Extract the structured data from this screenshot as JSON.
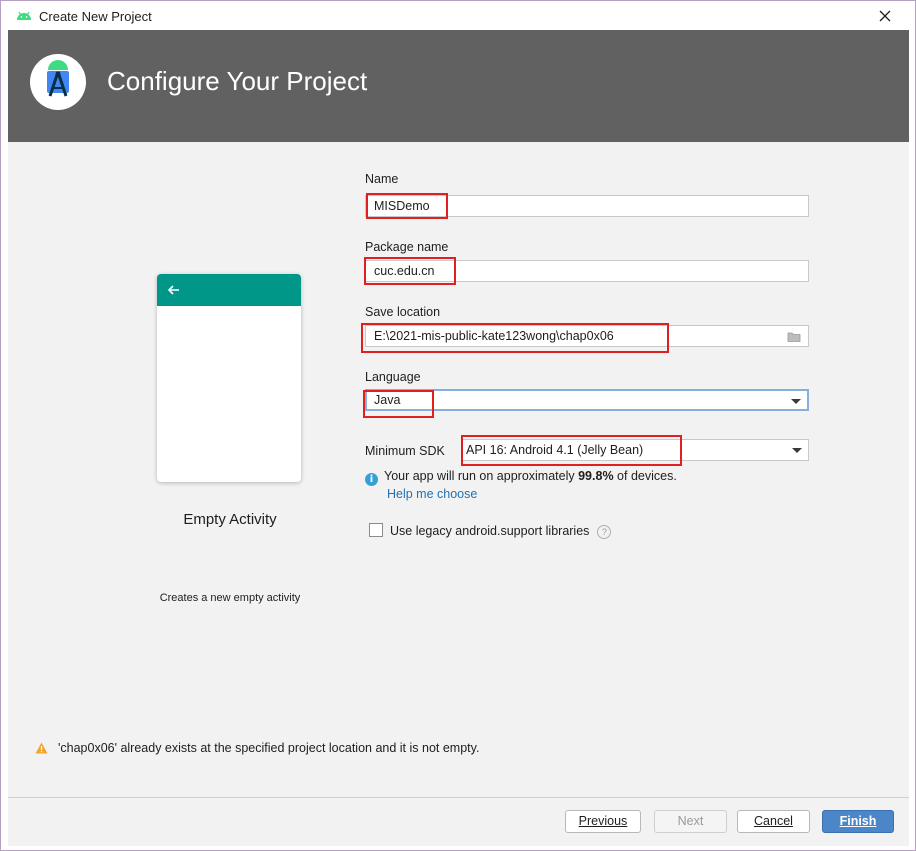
{
  "window": {
    "title": "Create New Project",
    "app_icon": "android-icon",
    "close_icon": "close-icon"
  },
  "header": {
    "title": "Configure Your Project",
    "logo_icon": "android-studio-logo-icon"
  },
  "template": {
    "name": "Empty Activity",
    "description": "Creates a new empty activity",
    "toolbar_icon": "back-arrow-icon",
    "toolbar_color": "#009688"
  },
  "form": {
    "name_label": "Name",
    "name_value": "MISDemo",
    "package_label": "Package name",
    "package_value": "cuc.edu.cn",
    "save_label": "Save location",
    "save_value": "E:\\2021-mis-public-kate123wong\\chap0x06",
    "save_icon": "folder-icon",
    "language_label": "Language",
    "language_value": "Java",
    "sdk_label": "Minimum SDK",
    "sdk_value": "API 16: Android 4.1 (Jelly Bean)",
    "info_icon": "info-icon",
    "info_prefix": "Your app will run on approximately",
    "info_percent": "99.8%",
    "info_suffix": "of devices.",
    "help_link": "Help me choose",
    "legacy_label": "Use legacy android.support libraries",
    "legacy_checked": false,
    "help_icon": "question-icon"
  },
  "warning": {
    "icon": "warning-icon",
    "text": "'chap0x06' already exists at the specified project location and it is not empty."
  },
  "footer": {
    "previous": "Previous",
    "next": "Next",
    "cancel": "Cancel",
    "finish": "Finish"
  },
  "colors": {
    "header_bg": "#616161",
    "accent": "#4a86c8",
    "highlight": "#e02020"
  }
}
